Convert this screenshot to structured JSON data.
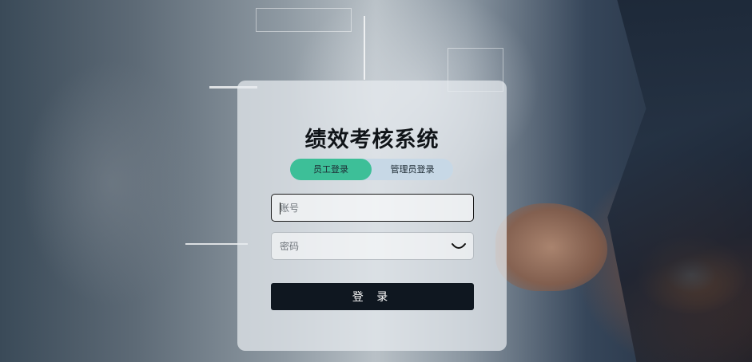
{
  "app": {
    "title": "绩效考核系统"
  },
  "tabs": [
    {
      "label": "员工登录",
      "active": true
    },
    {
      "label": "管理员登录",
      "active": false
    }
  ],
  "form": {
    "account": {
      "placeholder": "账号",
      "value": ""
    },
    "password": {
      "placeholder": "密码",
      "value": ""
    },
    "submit_label": "登 录"
  },
  "colors": {
    "accent": "#3dbf98",
    "tab_track": "#c7d8e6",
    "button_bg": "#0f1720",
    "title_text": "#101418"
  },
  "icons": {
    "password_toggle": "eye-closed-icon"
  }
}
